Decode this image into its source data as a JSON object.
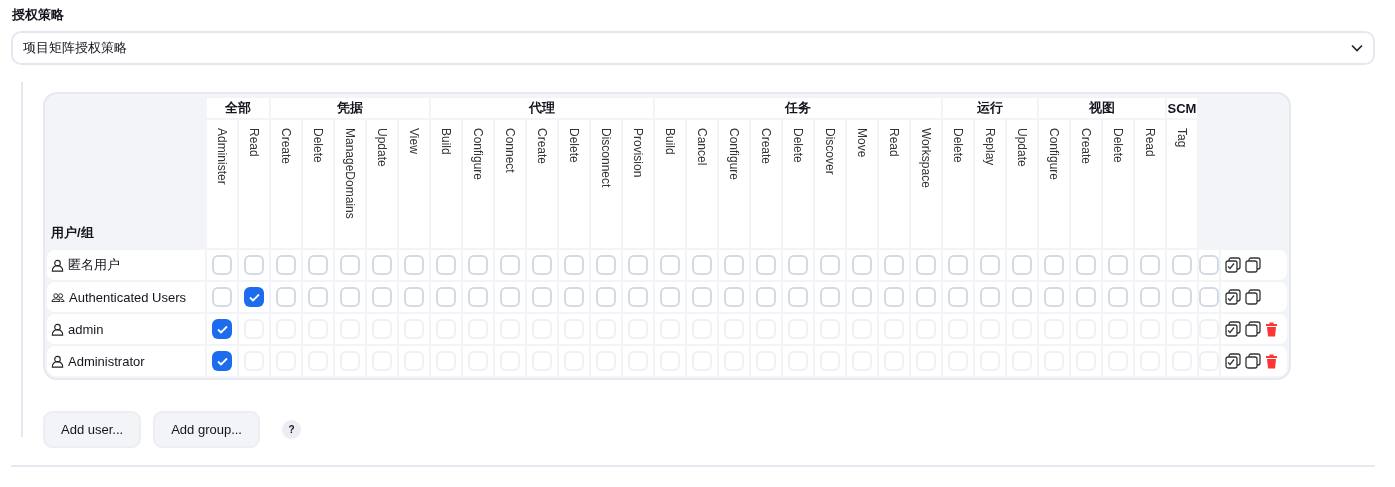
{
  "strategy": {
    "label": "授权策略",
    "value": "项目矩阵授权策略"
  },
  "matrix": {
    "user_header": "用户/组",
    "groups": [
      {
        "name": "全部",
        "permissions": [
          "Administer",
          "Read"
        ]
      },
      {
        "name": "凭据",
        "permissions": [
          "Create",
          "Delete",
          "ManageDomains",
          "Update",
          "View"
        ]
      },
      {
        "name": "代理",
        "permissions": [
          "Build",
          "Configure",
          "Connect",
          "Create",
          "Delete",
          "Disconnect",
          "Provision"
        ]
      },
      {
        "name": "任务",
        "permissions": [
          "Build",
          "Cancel",
          "Configure",
          "Create",
          "Delete",
          "Discover",
          "Move",
          "Read",
          "Workspace"
        ]
      },
      {
        "name": "运行",
        "permissions": [
          "Delete",
          "Replay",
          "Update"
        ]
      },
      {
        "name": "视图",
        "permissions": [
          "Configure",
          "Create",
          "Delete",
          "Read"
        ]
      },
      {
        "name": "SCM",
        "permissions": [
          "Tag"
        ]
      }
    ],
    "rows": [
      {
        "kind": "user",
        "name": "匿名用户",
        "removable": false,
        "disabled_except_first": false,
        "checked": [
          false,
          false,
          false,
          false,
          false,
          false,
          false,
          false,
          false,
          false,
          false,
          false,
          false,
          false,
          false,
          false,
          false,
          false,
          false,
          false,
          false,
          false,
          false,
          false,
          false,
          false,
          false,
          false,
          false,
          false,
          false,
          false
        ]
      },
      {
        "kind": "group",
        "name": "Authenticated Users",
        "removable": false,
        "disabled_except_first": false,
        "checked": [
          false,
          true,
          false,
          false,
          false,
          false,
          false,
          false,
          false,
          false,
          false,
          false,
          false,
          false,
          false,
          false,
          false,
          false,
          false,
          false,
          false,
          false,
          false,
          false,
          false,
          false,
          false,
          false,
          false,
          false,
          false,
          false
        ]
      },
      {
        "kind": "user",
        "name": "admin",
        "removable": true,
        "disabled_except_first": true,
        "checked": [
          true,
          false,
          false,
          false,
          false,
          false,
          false,
          false,
          false,
          false,
          false,
          false,
          false,
          false,
          false,
          false,
          false,
          false,
          false,
          false,
          false,
          false,
          false,
          false,
          false,
          false,
          false,
          false,
          false,
          false,
          false,
          false
        ]
      },
      {
        "kind": "user",
        "name": "Administrator",
        "removable": true,
        "disabled_except_first": true,
        "checked": [
          true,
          false,
          false,
          false,
          false,
          false,
          false,
          false,
          false,
          false,
          false,
          false,
          false,
          false,
          false,
          false,
          false,
          false,
          false,
          false,
          false,
          false,
          false,
          false,
          false,
          false,
          false,
          false,
          false,
          false,
          false,
          false
        ]
      }
    ]
  },
  "buttons": [
    "Add user...",
    "Add group..."
  ],
  "help": "?"
}
